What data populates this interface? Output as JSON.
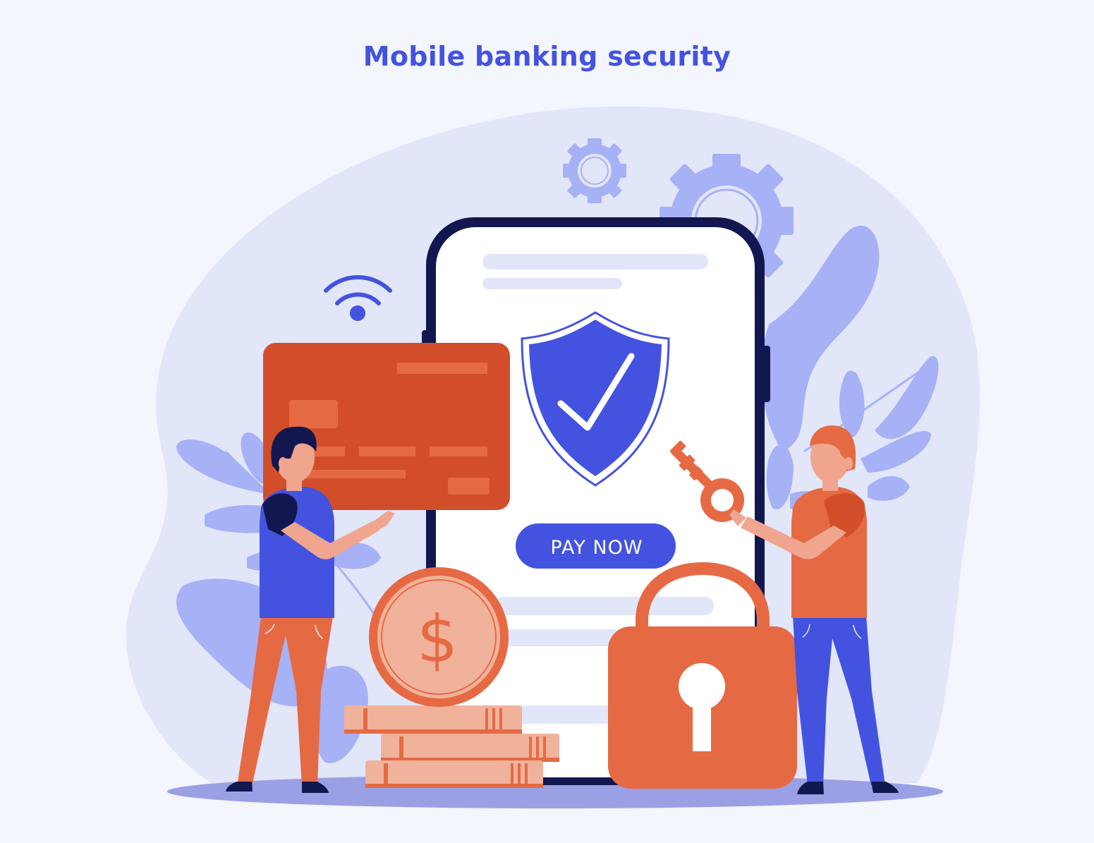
{
  "title": "Mobile banking security",
  "phone": {
    "pay_button_label": "PAY NOW"
  },
  "coin": {
    "symbol": "$"
  },
  "colors": {
    "background": "#f3f6fd",
    "blob": "#e2e6f9",
    "leaf": "#a7b1f5",
    "primary_blue": "#4453df",
    "navy": "#131750",
    "orange": "#e56a44",
    "card_red": "#d24e2a",
    "peach": "#f1b29b",
    "skin": "#f0a58e",
    "ground": "#9ba0e4"
  },
  "icons": [
    "wifi-icon",
    "gear-icon",
    "shield-check-icon",
    "key-icon",
    "padlock-icon",
    "credit-card-icon",
    "dollar-coin-icon",
    "leaf-plant"
  ]
}
